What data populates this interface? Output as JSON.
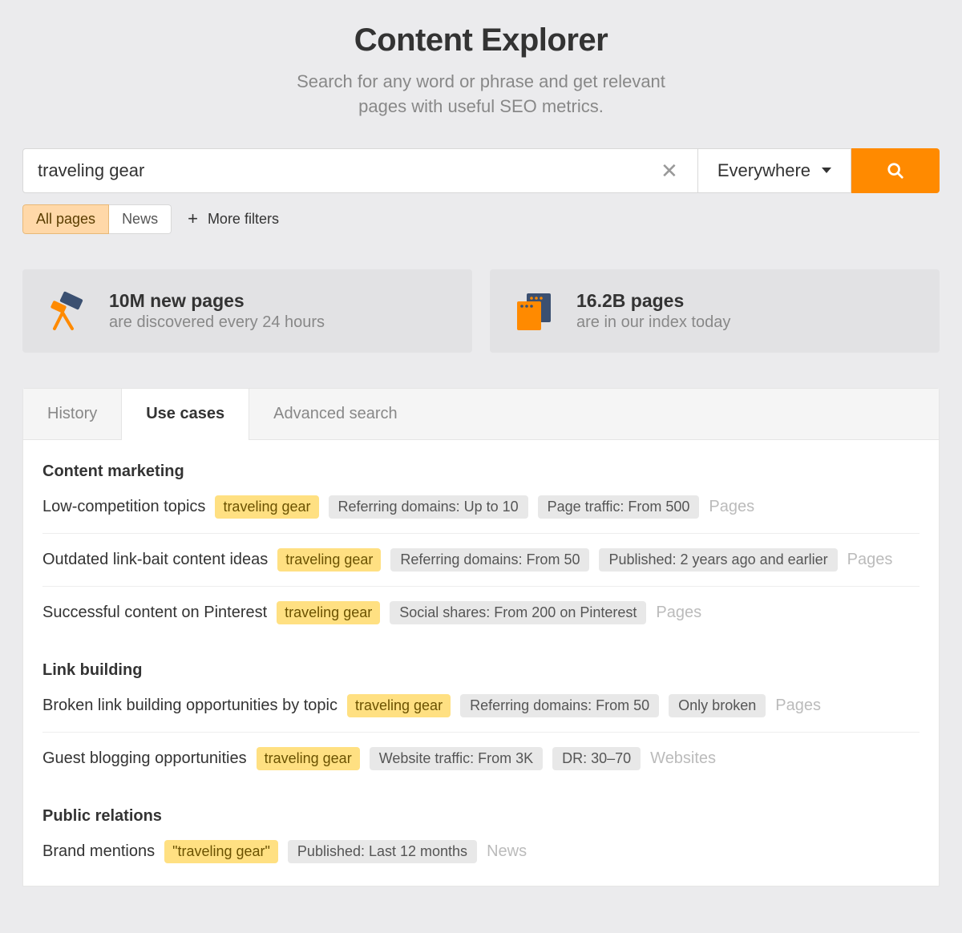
{
  "header": {
    "title": "Content Explorer",
    "subtitle_line1": "Search for any word or phrase and get relevant",
    "subtitle_line2": "pages with useful SEO metrics."
  },
  "search": {
    "value": "traveling gear",
    "scope": "Everywhere"
  },
  "filter_tabs": {
    "all_pages": "All pages",
    "news": "News",
    "more_filters": "More filters"
  },
  "stats": {
    "discovery": {
      "title": "10M new pages",
      "subtitle": "are discovered every 24 hours"
    },
    "index": {
      "title": "16.2B pages",
      "subtitle": "are in our index today"
    }
  },
  "tabs": {
    "history": "History",
    "use_cases": "Use cases",
    "advanced_search": "Advanced search"
  },
  "sections": {
    "content_marketing": {
      "title": "Content marketing",
      "rows": {
        "low_competition": {
          "label": "Low-competition topics",
          "keyword": "traveling gear",
          "tag1": "Referring domains: Up to 10",
          "tag2": "Page traffic: From 500",
          "suffix": "Pages"
        },
        "outdated": {
          "label": "Outdated link-bait content ideas",
          "keyword": "traveling gear",
          "tag1": "Referring domains: From 50",
          "tag2": "Published: 2 years ago and earlier",
          "suffix": "Pages"
        },
        "pinterest": {
          "label": "Successful content on Pinterest",
          "keyword": "traveling gear",
          "tag1": "Social shares: From 200 on Pinterest",
          "suffix": "Pages"
        }
      }
    },
    "link_building": {
      "title": "Link building",
      "rows": {
        "broken": {
          "label": "Broken link building opportunities by topic",
          "keyword": "traveling gear",
          "tag1": "Referring domains: From 50",
          "tag2": "Only broken",
          "suffix": "Pages"
        },
        "guest": {
          "label": "Guest blogging opportunities",
          "keyword": "traveling gear",
          "tag1": "Website traffic: From 3K",
          "tag2": "DR: 30–70",
          "suffix": "Websites"
        }
      }
    },
    "public_relations": {
      "title": "Public relations",
      "rows": {
        "brand": {
          "label": "Brand mentions",
          "keyword": "\"traveling gear\"",
          "tag1": "Published: Last 12 months",
          "suffix": "News"
        }
      }
    }
  }
}
